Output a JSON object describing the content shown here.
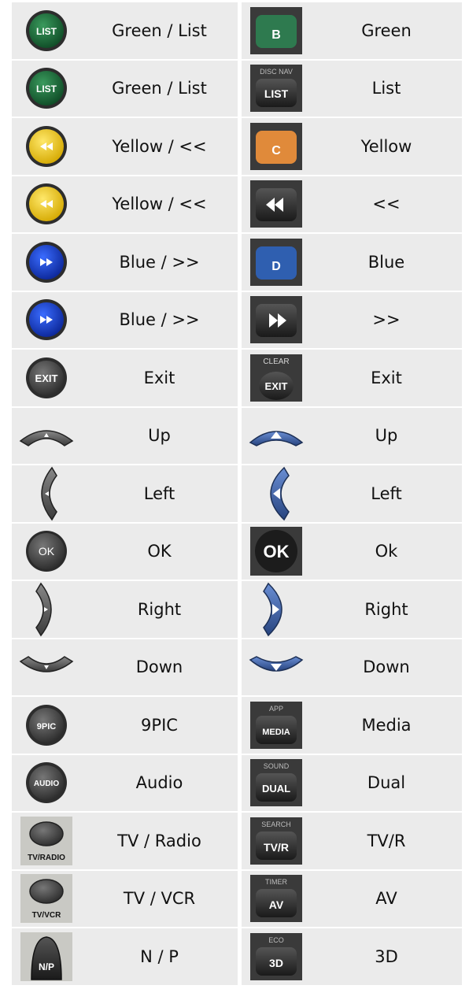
{
  "rows": [
    {
      "left": {
        "icon": "green-list-button-icon",
        "label": "Green / List"
      },
      "right": {
        "icon": "green-b-button-icon",
        "label": "Green"
      }
    },
    {
      "left": {
        "icon": "green-list-button-icon",
        "label": "Green / List"
      },
      "right": {
        "icon": "list-disc-nav-button-icon",
        "label": "List"
      }
    },
    {
      "left": {
        "icon": "yellow-rewind-button-icon",
        "label": "Yellow / <<"
      },
      "right": {
        "icon": "orange-c-button-icon",
        "label": "Yellow"
      }
    },
    {
      "left": {
        "icon": "yellow-rewind-button-icon",
        "label": "Yellow / <<"
      },
      "right": {
        "icon": "rewind-button-icon",
        "label": "<<"
      }
    },
    {
      "left": {
        "icon": "blue-forward-button-icon",
        "label": "Blue / >>"
      },
      "right": {
        "icon": "blue-d-button-icon",
        "label": "Blue"
      }
    },
    {
      "left": {
        "icon": "blue-forward-button-icon",
        "label": "Blue / >>"
      },
      "right": {
        "icon": "forward-button-icon",
        "label": ">>"
      }
    },
    {
      "left": {
        "icon": "exit-button-icon",
        "label": "Exit"
      },
      "right": {
        "icon": "exit-clear-button-icon",
        "label": "Exit"
      }
    },
    {
      "left": {
        "icon": "up-arrow-button-icon",
        "label": "Up"
      },
      "right": {
        "icon": "blue-up-arrow-button-icon",
        "label": "Up"
      }
    },
    {
      "left": {
        "icon": "left-arrow-button-icon",
        "label": "Left"
      },
      "right": {
        "icon": "blue-left-arrow-button-icon",
        "label": "Left"
      }
    },
    {
      "left": {
        "icon": "ok-button-icon",
        "label": "OK"
      },
      "right": {
        "icon": "dark-ok-button-icon",
        "label": "Ok"
      }
    },
    {
      "left": {
        "icon": "right-arrow-button-icon",
        "label": "Right"
      },
      "right": {
        "icon": "blue-right-arrow-button-icon",
        "label": "Right"
      }
    },
    {
      "left": {
        "icon": "down-arrow-button-icon",
        "label": "Down"
      },
      "right": {
        "icon": "blue-down-arrow-button-icon",
        "label": "Down"
      }
    },
    {
      "left": {
        "icon": "9pic-button-icon",
        "label": "9PIC"
      },
      "right": {
        "icon": "media-app-button-icon",
        "label": "Media"
      }
    },
    {
      "left": {
        "icon": "audio-button-icon",
        "label": "Audio"
      },
      "right": {
        "icon": "dual-sound-button-icon",
        "label": "Dual"
      }
    },
    {
      "left": {
        "icon": "tv-radio-button-icon",
        "label": "TV / Radio"
      },
      "right": {
        "icon": "tvr-search-button-icon",
        "label": "TV/R"
      }
    },
    {
      "left": {
        "icon": "tv-vcr-button-icon",
        "label": "TV / VCR"
      },
      "right": {
        "icon": "av-timer-button-icon",
        "label": "AV"
      }
    },
    {
      "left": {
        "icon": "np-button-icon",
        "label": "N / P"
      },
      "right": {
        "icon": "3d-eco-button-icon",
        "label": "3D"
      }
    }
  ],
  "button_text": {
    "list": "LIST",
    "b": "B",
    "disc_nav": "DISC NAV",
    "c": "C",
    "d": "D",
    "exit": "EXIT",
    "clear": "CLEAR",
    "ok": "OK",
    "ok_dark": "OK",
    "pic9": "9PIC",
    "app": "APP",
    "media": "MEDIA",
    "audio": "AUDIO",
    "sound": "SOUND",
    "dual": "DUAL",
    "tvradio": "TV/RADIO",
    "search": "SEARCH",
    "tvr": "TV/R",
    "tvvcr": "TV/VCR",
    "timer": "TIMER",
    "av": "AV",
    "np": "N/P",
    "eco": "ECO",
    "d3": "3D"
  },
  "colors": {
    "green_button": "#1f6b3c",
    "green_b": "#2e7a4f",
    "yellow_button": "#f3cd1b",
    "orange_c": "#e08a3a",
    "blue_button": "#1f3fc4",
    "blue_d": "#2f5fb0",
    "nav_blue": "#3a5fa8",
    "dark_button": "#2a2a2a",
    "grey_button": "#4a4a4a"
  }
}
